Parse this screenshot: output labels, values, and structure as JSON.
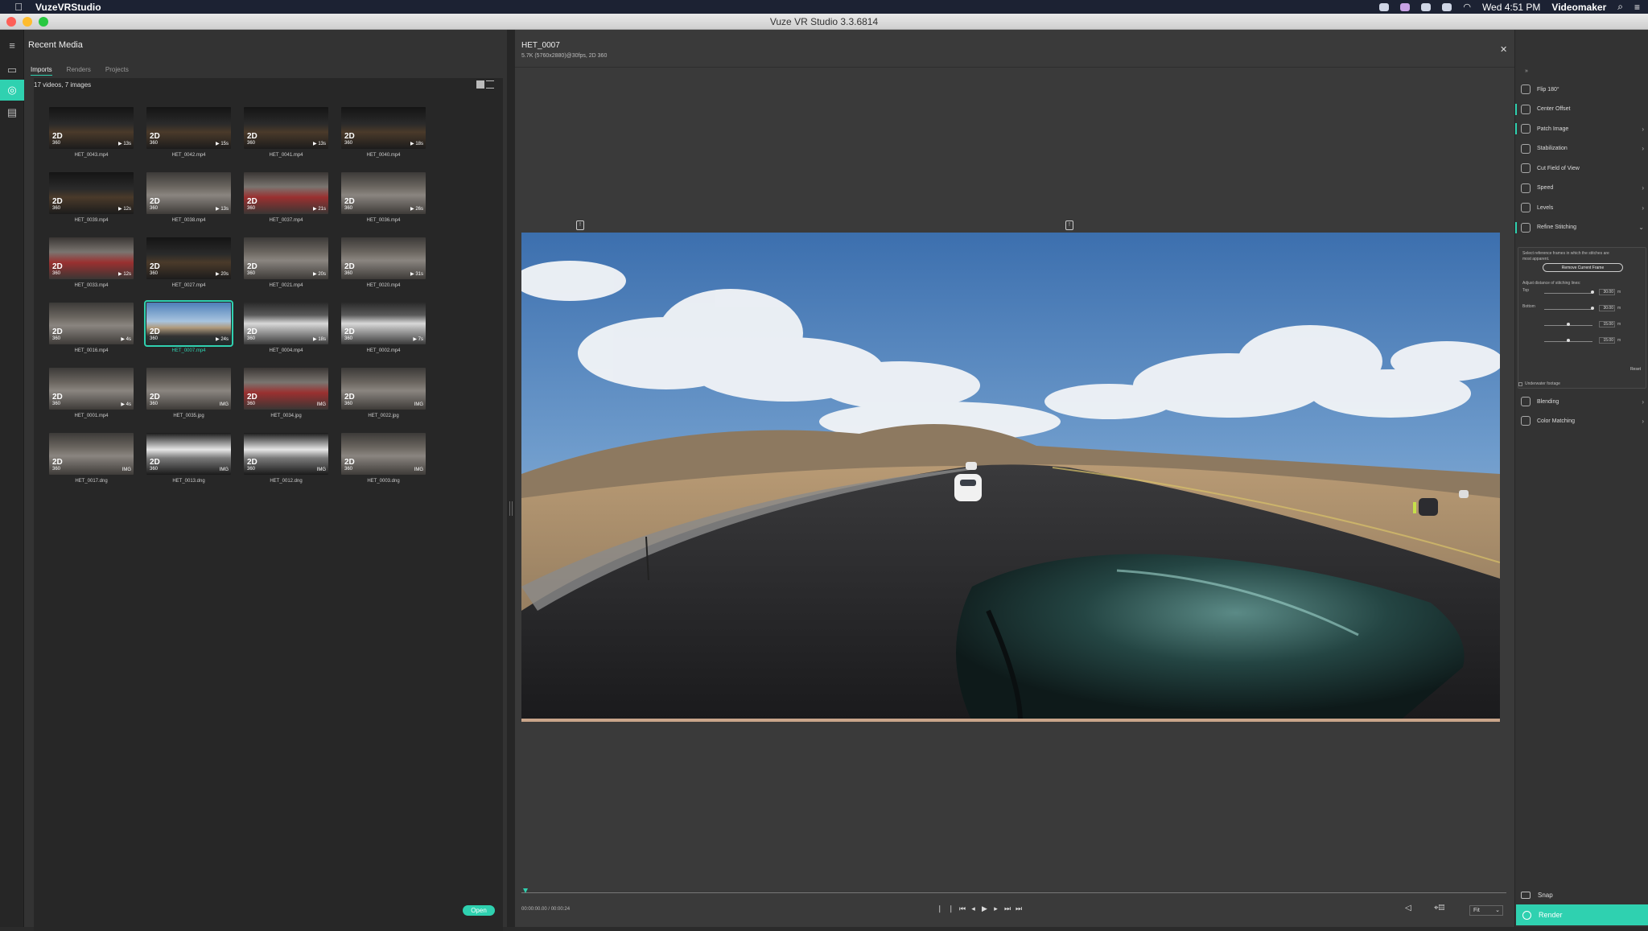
{
  "menubar": {
    "app_name": "VuzeVRStudio",
    "clock": "Wed 4:51 PM",
    "user": "Videomaker"
  },
  "window": {
    "title": "Vuze VR Studio 3.3.6814"
  },
  "media": {
    "header": "Recent Media",
    "tabs": [
      "Imports",
      "Renders",
      "Projects"
    ],
    "count": "17 videos, 7 images",
    "open_label": "Open",
    "items": [
      {
        "name": "HET_0043.mp4",
        "dur": "▶ 13s",
        "tone": "dark"
      },
      {
        "name": "HET_0042.mp4",
        "dur": "▶ 15s",
        "tone": "dark"
      },
      {
        "name": "HET_0041.mp4",
        "dur": "▶ 13s",
        "tone": "dark"
      },
      {
        "name": "HET_0040.mp4",
        "dur": "▶ 18s",
        "tone": "dark"
      },
      {
        "name": "HET_0039.mp4",
        "dur": "▶ 12s",
        "tone": "dark"
      },
      {
        "name": "HET_0038.mp4",
        "dur": "▶ 13s",
        "tone": "hall"
      },
      {
        "name": "HET_0037.mp4",
        "dur": "▶ 21s",
        "tone": "red"
      },
      {
        "name": "HET_0036.mp4",
        "dur": "▶ 26s",
        "tone": "hall"
      },
      {
        "name": "HET_0033.mp4",
        "dur": "▶ 12s",
        "tone": "red"
      },
      {
        "name": "HET_0027.mp4",
        "dur": "▶ 20s",
        "tone": "dark"
      },
      {
        "name": "HET_0021.mp4",
        "dur": "▶ 20s",
        "tone": "hall"
      },
      {
        "name": "HET_0020.mp4",
        "dur": "▶ 31s",
        "tone": "hall"
      },
      {
        "name": "HET_0016.mp4",
        "dur": "▶ 4s",
        "tone": "hall"
      },
      {
        "name": "HET_0007.mp4",
        "dur": "▶ 24s",
        "tone": "sky",
        "selected": true
      },
      {
        "name": "HET_0004.mp4",
        "dur": "▶ 18s",
        "tone": "road"
      },
      {
        "name": "HET_0002.mp4",
        "dur": "▶ 7s",
        "tone": "road"
      },
      {
        "name": "HET_0001.mp4",
        "dur": "▶ 4s",
        "tone": "hall"
      },
      {
        "name": "HET_0035.jpg",
        "dur": "IMG",
        "tone": "hall"
      },
      {
        "name": "HET_0034.jpg",
        "dur": "IMG",
        "tone": "red"
      },
      {
        "name": "HET_0022.jpg",
        "dur": "IMG",
        "tone": "hall"
      },
      {
        "name": "HET_0017.dng",
        "dur": "IMG",
        "tone": "hall"
      },
      {
        "name": "HET_0013.dng",
        "dur": "IMG",
        "tone": "bright"
      },
      {
        "name": "HET_0012.dng",
        "dur": "IMG",
        "tone": "bright"
      },
      {
        "name": "HET_0003.dng",
        "dur": "IMG",
        "tone": "hall"
      }
    ],
    "badge_top": "2D",
    "badge_bottom": "360"
  },
  "preview": {
    "file_name": "HET_0007",
    "file_meta": "5.7K (5760x2880)@30fps, 2D 360",
    "timecode": "00:00:00.00 / 00:00:24",
    "fit_label": "Fit",
    "marker_glyph": "!"
  },
  "tools": {
    "items": [
      {
        "label": "Flip 180°",
        "chev": ""
      },
      {
        "label": "Center Offset",
        "chev": "",
        "accent": true
      },
      {
        "label": "Patch Image",
        "chev": "›",
        "accent": true
      },
      {
        "label": "Stabilization",
        "chev": "›"
      },
      {
        "label": "Cut Field of View",
        "chev": ""
      },
      {
        "label": "Speed",
        "chev": "›"
      },
      {
        "label": "Levels",
        "chev": "›"
      },
      {
        "label": "Refine Stitching",
        "chev": "⌄",
        "accent": true
      }
    ],
    "after": [
      {
        "label": "Blending",
        "chev": "›"
      },
      {
        "label": "Color Matching",
        "chev": "›"
      }
    ],
    "refine": {
      "note": "Select reference frames in which the stitches are most apparent.",
      "remove_label": "Remove Current Frame",
      "adjust_label": "Adjust distance of stitching lines:",
      "rows": [
        {
          "label": "Top",
          "value": "30.00",
          "unit": "m"
        },
        {
          "label": "Bottom",
          "value": "30.00",
          "unit": "m"
        },
        {
          "label": "",
          "value": "15.00",
          "unit": "m"
        },
        {
          "label": "",
          "value": "15.00",
          "unit": "m"
        }
      ],
      "reset_label": "Reset",
      "underwater_label": "Underwater footage"
    },
    "snap_label": "Snap",
    "render_label": "Render"
  }
}
